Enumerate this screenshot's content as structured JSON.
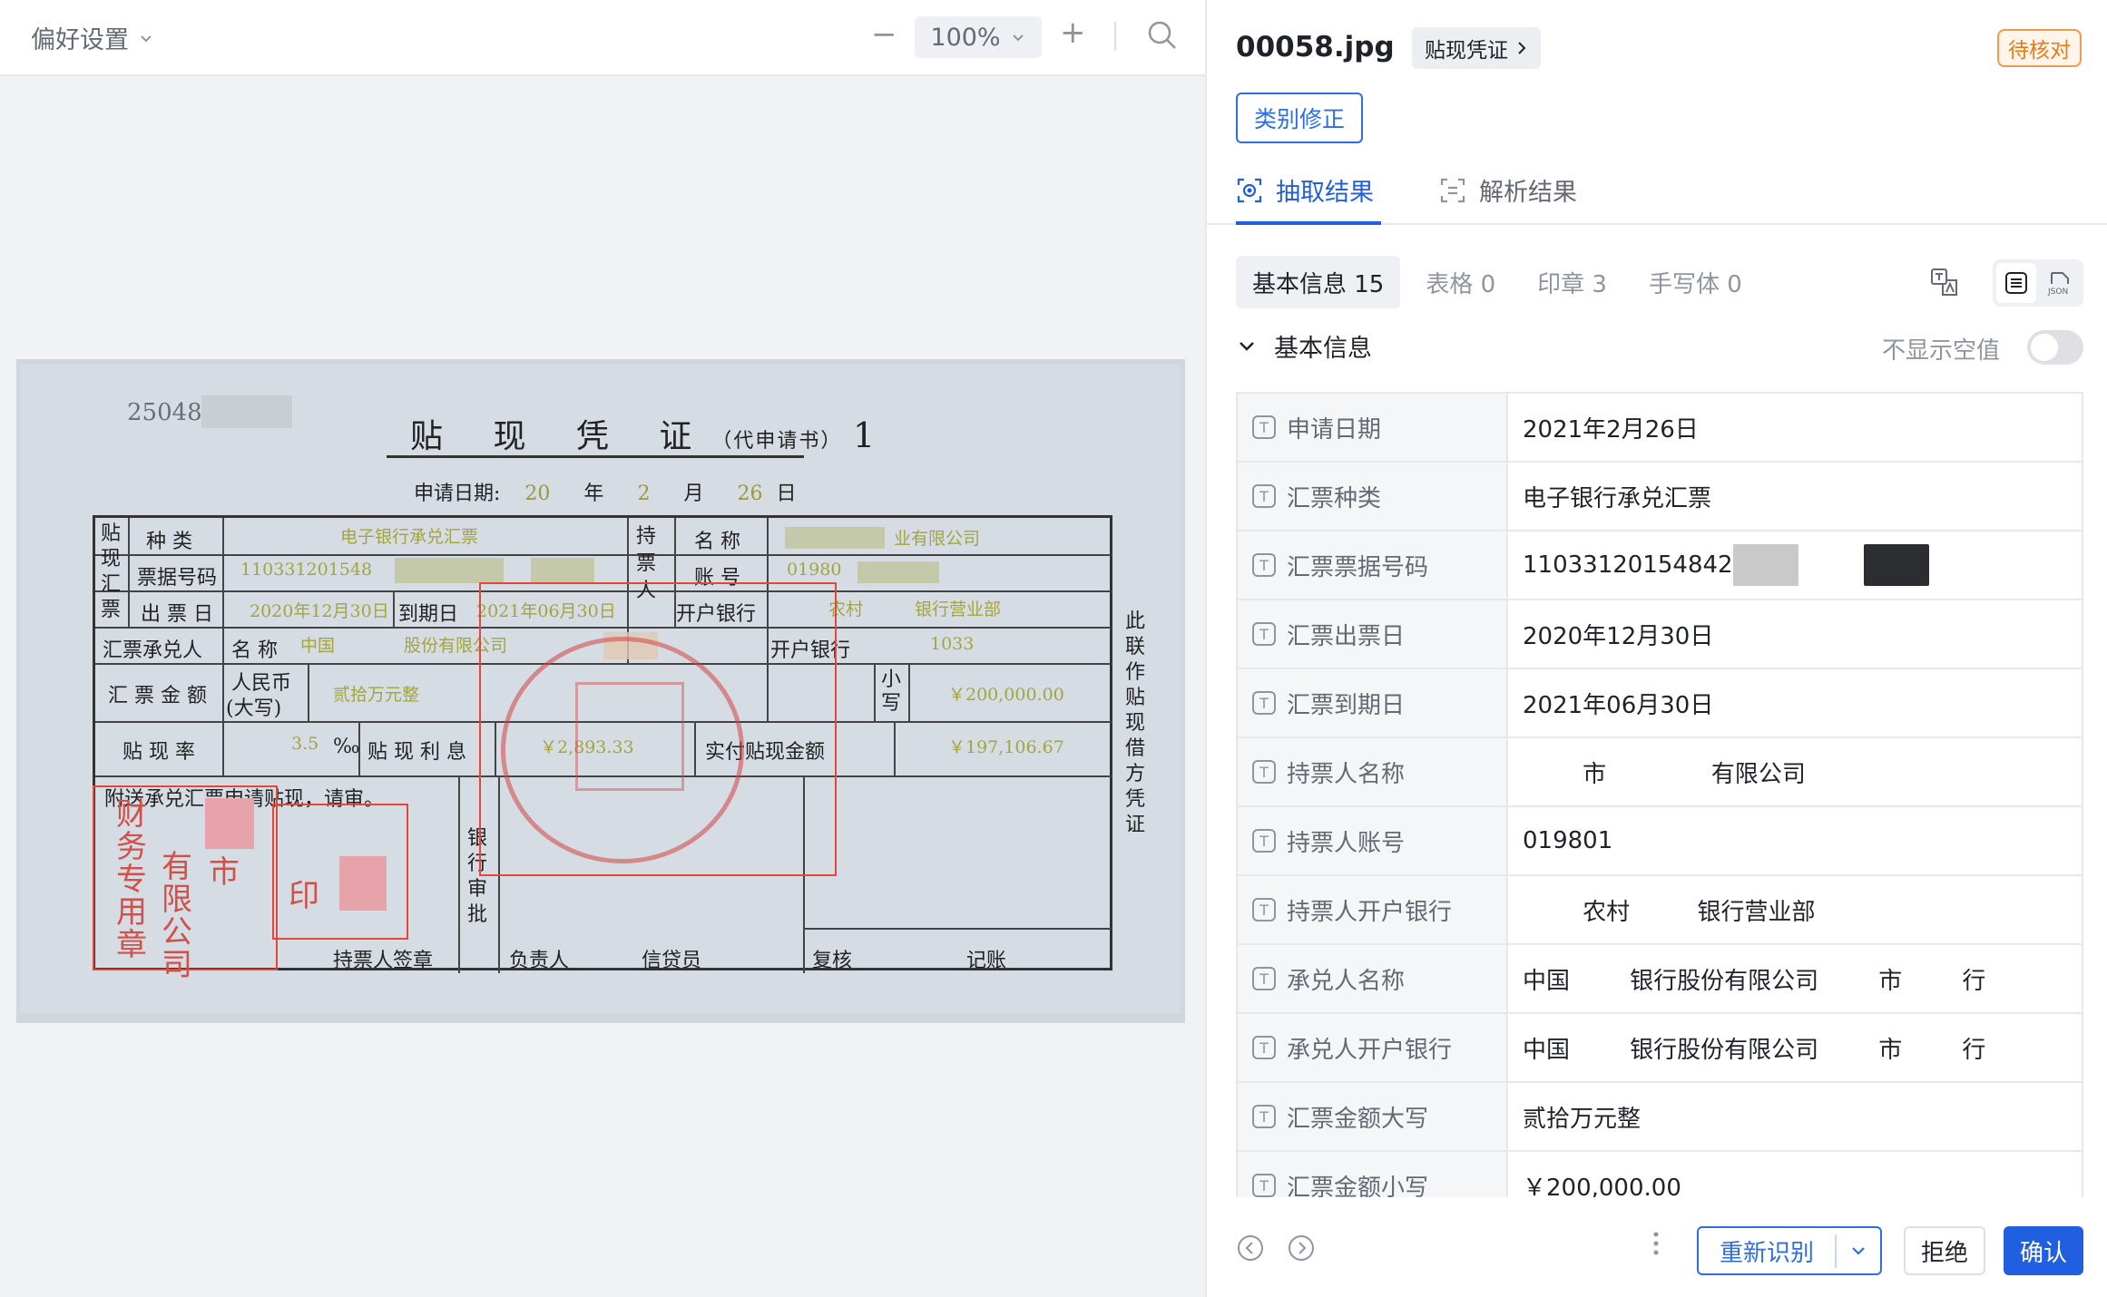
{
  "viewer": {
    "preferences_label": "偏好设置",
    "zoom_value": "100%",
    "zoom_minus": "−",
    "zoom_plus": "+"
  },
  "document": {
    "number": "25048",
    "title": "贴 现 凭 证",
    "title_sub": "（代申请书）",
    "copy_no": "1",
    "apply_date_label": "申请日期:",
    "apply_date_year_hand": "20",
    "year": "年",
    "apply_date_month_hand": "2",
    "month": "月",
    "apply_date_day_hand": "26",
    "day": "日",
    "labels": {
      "tiexian_huipiao": "贴现汇票",
      "zhonglei": "种 类",
      "piaoju_haoma": "票据号码",
      "chupiao_ri": "出 票 日",
      "daoqi_ri": "到期日",
      "chengduiren": "汇票承兑人",
      "mingcheng": "名 称",
      "kaihu_yinhang": "开户银行",
      "huipiao_jine": "汇 票 金 额",
      "renminbi": "人民币",
      "daxie": "(大写)",
      "xiaoxie": "小写",
      "tiexianlv": "贴 现 率",
      "percent": "‰",
      "tiexian_lixi": "贴 现 利 息",
      "shifu_jine": "实付贴现金额",
      "chipiaoren": "持票人",
      "chipiao_mingcheng": "名 称",
      "zhanghao": "账 号",
      "fusong": "附送承兑汇票申请贴现，请审。",
      "yinhang_shenpi": "银行审批",
      "chipiaoren_qianzhang": "持票人签章",
      "fuzeren": "负责人",
      "xindaiyuan": "信贷员",
      "fuhe": "复核",
      "jizhang": "记账",
      "side_note": "此联作贴现借方凭证"
    },
    "hand": {
      "zhonglei": "电子银行承兑汇票",
      "piaoju_haoma": "110331201548",
      "chupiao_ri": "2020年12月30日",
      "daoqi_ri": "2021年06月30日",
      "chengdui_name": "中国　　　　股份有限公司",
      "chengdui_bank": "1033",
      "daxie": "贰拾万元整",
      "xiaoxie": "￥200,000.00",
      "rate": "3.5",
      "lixi": "￥2,893.33",
      "shifu": "￥197,106.67",
      "holder_name": "业有限公司",
      "holder_account": "01980",
      "holder_bank": "农村　　　银行营业部"
    },
    "seal_text_1": "财务专用章",
    "seal_text_2": "有限公司",
    "seal_text_3": "市",
    "seal_text_4": "印"
  },
  "panel": {
    "filename": "00058.jpg",
    "type_tag": "贴现凭证",
    "status": "待核对",
    "fix_button": "类别修正",
    "tabs": [
      {
        "label": "抽取结果"
      },
      {
        "label": "解析结果"
      }
    ],
    "subtabs": [
      {
        "label": "基本信息 15"
      },
      {
        "label": "表格 0"
      },
      {
        "label": "印章 3"
      },
      {
        "label": "手写体 0"
      }
    ],
    "section_title": "基本信息",
    "hide_empty_label": "不显示空值",
    "fields": [
      {
        "key": "申请日期",
        "value": "2021年2月26日"
      },
      {
        "key": "汇票种类",
        "value": "电子银行承兑汇票"
      },
      {
        "key": "汇票票据号码",
        "value": "110331201548­42"
      },
      {
        "key": "汇票出票日",
        "value": "2020年12月30日"
      },
      {
        "key": "汇票到期日",
        "value": "2021年06月30日"
      },
      {
        "key": "持票人名称",
        "value": "        市              有限公司"
      },
      {
        "key": "持票人账号",
        "value": "019801"
      },
      {
        "key": "持票人开户银行",
        "value": "        农村         银行营业部"
      },
      {
        "key": "承兑人名称",
        "value": "中国        银行股份有限公司        市        行"
      },
      {
        "key": "承兑人开户银行",
        "value": "中国        银行股份有限公司        市        行"
      },
      {
        "key": "汇票金额大写",
        "value": "贰拾万元整"
      },
      {
        "key": "汇票金额小写",
        "value": "￥200,000.00"
      }
    ],
    "reidentify_button": "重新识别",
    "reject_button": "拒绝",
    "confirm_button": "确认"
  },
  "colors": {
    "accent": "#1f5fe0",
    "status_orange": "#ea7b14",
    "stamp_red": "#e4473a"
  }
}
